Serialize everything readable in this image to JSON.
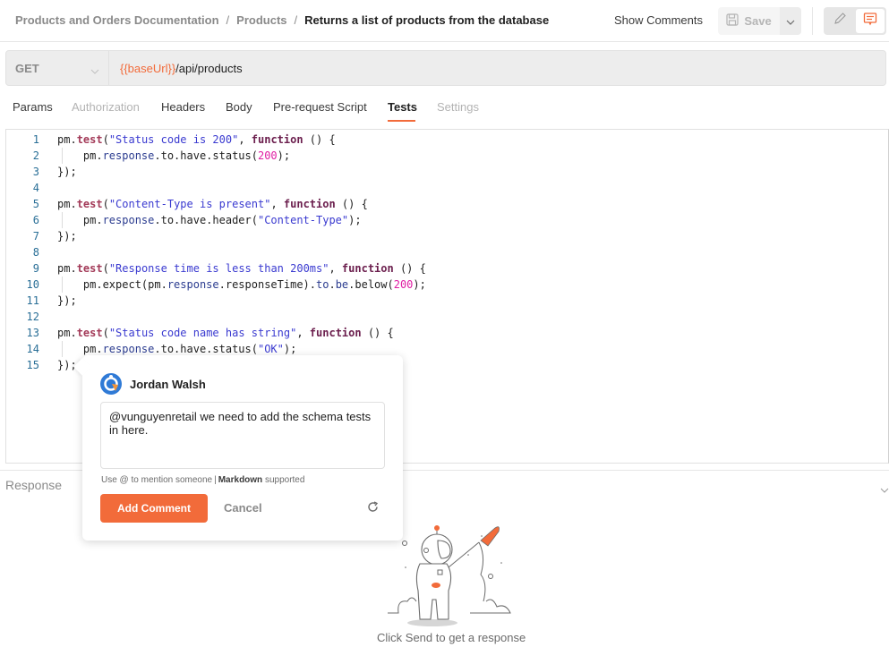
{
  "header": {
    "breadcrumb": [
      "Products and Orders Documentation",
      "Products",
      "Returns a list of products from the database"
    ],
    "breadcrumb_separator": "/",
    "show_comments_label": "Show Comments",
    "save_label": "Save",
    "icons": {
      "save": "floppy-disk-icon",
      "save_dropdown": "chevron-down-icon",
      "edit_mode": "pencil-icon",
      "comment_mode": "comment-icon"
    }
  },
  "request": {
    "method": "GET",
    "url_variable": "{{baseUrl}}",
    "url_path": "/api/products"
  },
  "tabs": [
    {
      "label": "Params",
      "state": "normal"
    },
    {
      "label": "Authorization",
      "state": "disabled"
    },
    {
      "label": "Headers",
      "state": "normal"
    },
    {
      "label": "Body",
      "state": "normal"
    },
    {
      "label": "Pre-request Script",
      "state": "normal"
    },
    {
      "label": "Tests",
      "state": "active"
    },
    {
      "label": "Settings",
      "state": "disabled"
    }
  ],
  "editor": {
    "lines": [
      {
        "n": "1",
        "segments": [
          [
            "pm.",
            ""
          ],
          [
            "test",
            "kw-test"
          ],
          [
            "(",
            ""
          ],
          [
            "\"Status code is 200\"",
            "str"
          ],
          [
            ", ",
            ""
          ],
          [
            "function",
            "kw-fn"
          ],
          [
            " () {",
            ""
          ]
        ]
      },
      {
        "n": "2",
        "segments": [
          [
            "    pm.",
            ""
          ],
          [
            "response",
            "prop"
          ],
          [
            ".to.have.status(",
            ""
          ],
          [
            "200",
            "num"
          ],
          [
            ");",
            ""
          ]
        ],
        "guide": true
      },
      {
        "n": "3",
        "segments": [
          [
            "});",
            ""
          ]
        ]
      },
      {
        "n": "4",
        "segments": []
      },
      {
        "n": "5",
        "segments": [
          [
            "pm.",
            ""
          ],
          [
            "test",
            "kw-test"
          ],
          [
            "(",
            ""
          ],
          [
            "\"Content-Type is present\"",
            "str"
          ],
          [
            ", ",
            ""
          ],
          [
            "function",
            "kw-fn"
          ],
          [
            " () {",
            ""
          ]
        ]
      },
      {
        "n": "6",
        "segments": [
          [
            "    pm.",
            ""
          ],
          [
            "response",
            "prop"
          ],
          [
            ".to.have.header(",
            ""
          ],
          [
            "\"Content-Type\"",
            "str"
          ],
          [
            ");",
            ""
          ]
        ],
        "guide": true
      },
      {
        "n": "7",
        "segments": [
          [
            "});",
            ""
          ]
        ]
      },
      {
        "n": "8",
        "segments": []
      },
      {
        "n": "9",
        "segments": [
          [
            "pm.",
            ""
          ],
          [
            "test",
            "kw-test"
          ],
          [
            "(",
            ""
          ],
          [
            "\"Response time is less than 200ms\"",
            "str"
          ],
          [
            ", ",
            ""
          ],
          [
            "function",
            "kw-fn"
          ],
          [
            " () {",
            ""
          ]
        ]
      },
      {
        "n": "10",
        "segments": [
          [
            "    pm.expect(pm.",
            ""
          ],
          [
            "response",
            "prop"
          ],
          [
            ".responseTime).",
            ""
          ],
          [
            "to",
            "prop"
          ],
          [
            ".",
            ""
          ],
          [
            "be",
            "prop"
          ],
          [
            ".below(",
            ""
          ],
          [
            "200",
            "num"
          ],
          [
            ");",
            ""
          ]
        ],
        "guide": true
      },
      {
        "n": "11",
        "segments": [
          [
            "});",
            ""
          ]
        ]
      },
      {
        "n": "12",
        "segments": []
      },
      {
        "n": "13",
        "segments": [
          [
            "pm.",
            ""
          ],
          [
            "test",
            "kw-test"
          ],
          [
            "(",
            ""
          ],
          [
            "\"Status code name has string\"",
            "str"
          ],
          [
            ", ",
            ""
          ],
          [
            "function",
            "kw-fn"
          ],
          [
            " () {",
            ""
          ]
        ]
      },
      {
        "n": "14",
        "segments": [
          [
            "    pm.",
            ""
          ],
          [
            "response",
            "prop"
          ],
          [
            ".to.have.status(",
            ""
          ],
          [
            "\"OK\"",
            "str"
          ],
          [
            ");",
            ""
          ]
        ],
        "guide": true
      },
      {
        "n": "15",
        "segments": [
          [
            "});",
            ""
          ]
        ]
      }
    ]
  },
  "comment": {
    "author": "Jordan Walsh",
    "avatar_icon": "user-avatar-icon",
    "text": "@vunguyenretail we need to add the schema tests in here.",
    "hint_prefix": "Use @ to mention someone",
    "hint_bold": "Markdown",
    "hint_suffix": "supported",
    "add_label": "Add Comment",
    "cancel_label": "Cancel",
    "refresh_icon": "refresh-icon"
  },
  "response": {
    "label": "Response",
    "empty_message": "Click Send to get a response",
    "illustration": "astronaut-rocket-illustration"
  },
  "colors": {
    "accent": "#f26b3a",
    "variable": "#f26b3a",
    "string": "#3a3ad0",
    "number": "#e01ea3",
    "keyword": "#6b1e4d",
    "line_number": "#2a6f97"
  }
}
